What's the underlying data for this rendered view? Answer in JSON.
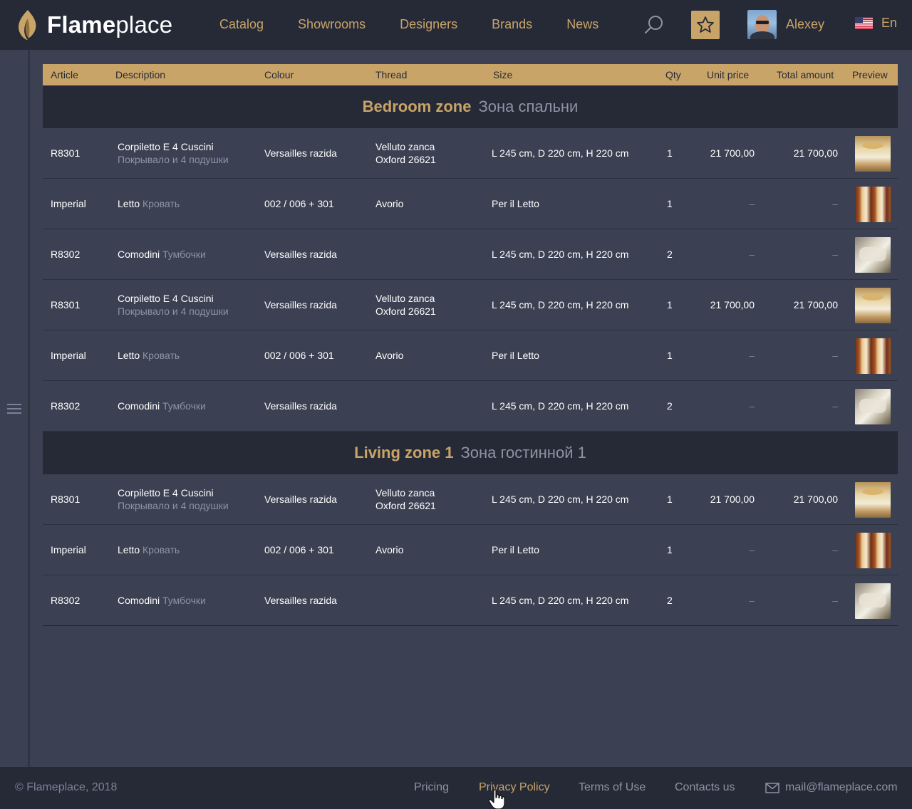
{
  "brand": {
    "bold": "Flame",
    "light": "place"
  },
  "nav": [
    "Catalog",
    "Showrooms",
    "Designers",
    "Brands",
    "News"
  ],
  "user": {
    "name": "Alexey"
  },
  "lang": {
    "label": "En"
  },
  "table": {
    "headers": [
      "Article",
      "Description",
      "Colour",
      "Thread",
      "Size",
      "Qty",
      "Unit price",
      "Total amount",
      "Preview"
    ],
    "zones": [
      {
        "name": "Bedroom zone",
        "name_ru": "Зона спальни",
        "rows": [
          {
            "article": "R8301",
            "desc": "Corpiletto E 4 Cuscini",
            "desc_ru": "Покрывало и 4 подушки",
            "colour": "Versailles razida",
            "thread1": "Velluto zanca",
            "thread2": "Oxford 26621",
            "size": "L 245 cm, D 220 cm, H 220 cm",
            "qty": "1",
            "unit": "21 700,00",
            "total": "21 700,00",
            "preview": "bedspread-thumbnail"
          },
          {
            "article": "Imperial",
            "desc": "Letto",
            "desc_ru": "Кровать",
            "colour": "002 / 006 + 301",
            "thread1": "Avorio",
            "thread2": "",
            "size": "Per il Letto",
            "qty": "1",
            "unit": "–",
            "total": "–",
            "preview": "bed-thumbnail"
          },
          {
            "article": "R8302",
            "desc": "Comodini",
            "desc_ru": "Тумбочки",
            "colour": "Versailles razida",
            "thread1": "",
            "thread2": "",
            "size": "L 245 cm, D 220 cm, H 220 cm",
            "qty": "2",
            "unit": "–",
            "total": "–",
            "preview": "nightstand-thumbnail"
          },
          {
            "article": "R8301",
            "desc": "Corpiletto E 4 Cuscini",
            "desc_ru": "Покрывало и 4 подушки",
            "colour": "Versailles razida",
            "thread1": "Velluto zanca",
            "thread2": "Oxford 26621",
            "size": "L 245 cm, D 220 cm, H 220 cm",
            "qty": "1",
            "unit": "21 700,00",
            "total": "21 700,00",
            "preview": "bedspread-thumbnail"
          },
          {
            "article": "Imperial",
            "desc": "Letto",
            "desc_ru": "Кровать",
            "colour": "002 / 006 + 301",
            "thread1": "Avorio",
            "thread2": "",
            "size": "Per il Letto",
            "qty": "1",
            "unit": "–",
            "total": "–",
            "preview": "bed-thumbnail"
          },
          {
            "article": "R8302",
            "desc": "Comodini",
            "desc_ru": "Тумбочки",
            "colour": "Versailles razida",
            "thread1": "",
            "thread2": "",
            "size": "L 245 cm, D 220 cm, H 220 cm",
            "qty": "2",
            "unit": "–",
            "total": "–",
            "preview": "nightstand-thumbnail"
          }
        ]
      },
      {
        "name": "Living zone 1",
        "name_ru": "Зона гостинной 1",
        "rows": [
          {
            "article": "R8301",
            "desc": "Corpiletto E 4 Cuscini",
            "desc_ru": "Покрывало и 4 подушки",
            "colour": "Versailles razida",
            "thread1": "Velluto zanca",
            "thread2": "Oxford 26621",
            "size": "L 245 cm, D 220 cm, H 220 cm",
            "qty": "1",
            "unit": "21 700,00",
            "total": "21 700,00",
            "preview": "bedspread-thumbnail"
          },
          {
            "article": "Imperial",
            "desc": "Letto",
            "desc_ru": "Кровать",
            "colour": "002 / 006 + 301",
            "thread1": "Avorio",
            "thread2": "",
            "size": "Per il Letto",
            "qty": "1",
            "unit": "–",
            "total": "–",
            "preview": "bed-thumbnail"
          },
          {
            "article": "R8302",
            "desc": "Comodini",
            "desc_ru": "Тумбочки",
            "colour": "Versailles razida",
            "thread1": "",
            "thread2": "",
            "size": "L 245 cm, D 220 cm, H 220 cm",
            "qty": "2",
            "unit": "–",
            "total": "–",
            "preview": "nightstand-thumbnail"
          }
        ]
      }
    ]
  },
  "footer": {
    "copyright": "© Flameplace, 2018",
    "links": [
      "Pricing",
      "Privacy Policy",
      "Terms of Use",
      "Contacts us"
    ],
    "active_link": "Privacy Policy",
    "email": "mail@flameplace.com"
  },
  "colors": {
    "accent": "#c9a468",
    "background": "#3b4152",
    "dark": "#262a37",
    "muted": "#8d93a4"
  }
}
